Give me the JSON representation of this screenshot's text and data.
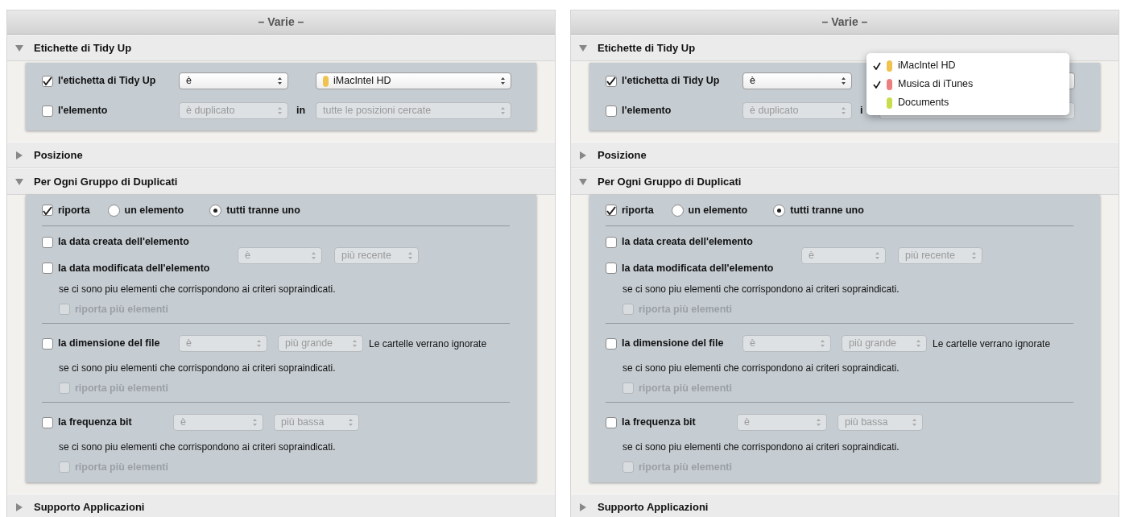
{
  "panels": [
    {
      "title": "– Varie –",
      "sections": [
        {
          "title": "Etichette di Tidy Up",
          "expanded": true,
          "rows": [
            {
              "kind": "tag",
              "items": [
                {
                  "kind": "checkbox",
                  "label": "l'etichetta di Tidy Up",
                  "checked": true,
                  "disabled": false
                },
                {
                  "kind": "popup",
                  "value": "è",
                  "disabled": false
                },
                {
                  "kind": "popup",
                  "value": "iMacIntel HD",
                  "disabled": false,
                  "color": "#f0c24e"
                }
              ]
            },
            {
              "kind": "tag",
              "items": [
                {
                  "kind": "checkbox",
                  "label": "l'elemento",
                  "checked": false,
                  "disabled": false
                },
                {
                  "kind": "popup",
                  "value": "è duplicato",
                  "disabled": true
                },
                {
                  "kind": "text",
                  "text": "in"
                },
                {
                  "kind": "popup",
                  "value": "tutte le posizioni cercate",
                  "disabled": true
                }
              ]
            }
          ]
        },
        {
          "title": "Posizione",
          "expanded": false
        },
        {
          "title": "Per Ogni Gruppo di Duplicati",
          "expanded": true,
          "rows": [
            {
              "kind": "choice",
              "items": [
                {
                  "kind": "checkbox",
                  "label": "riporta",
                  "checked": true,
                  "disabled": false
                },
                {
                  "kind": "radio",
                  "label": "un elemento",
                  "selected": false
                },
                {
                  "kind": "radio",
                  "label": "tutti tranne uno",
                  "selected": true
                }
              ]
            },
            {
              "kind": "divider"
            },
            {
              "kind": "date",
              "items": [
                {
                  "kind": "checkbox",
                  "label": "la data creata dell'elemento",
                  "checked": false,
                  "disabled": false
                },
                {
                  "kind": "checkbox",
                  "label": "la data modificata dell'elemento",
                  "checked": false,
                  "disabled": false
                },
                {
                  "kind": "popup",
                  "value": "è",
                  "disabled": true
                },
                {
                  "kind": "popup",
                  "value": "più recente",
                  "disabled": true
                }
              ]
            },
            {
              "kind": "note",
              "text": "se ci sono piu elementi che corrispondono ai criteri sopraindicati."
            },
            {
              "kind": "sub",
              "items": [
                {
                  "kind": "checkbox",
                  "label": "riporta più elementi",
                  "checked": false,
                  "disabled": true
                }
              ]
            },
            {
              "kind": "divider"
            },
            {
              "kind": "size",
              "items": [
                {
                  "kind": "checkbox",
                  "label": "la dimensione del file",
                  "checked": false,
                  "disabled": false
                },
                {
                  "kind": "popup",
                  "value": "è",
                  "disabled": true
                },
                {
                  "kind": "popup",
                  "value": "più grande",
                  "disabled": true
                },
                {
                  "kind": "text",
                  "text": "Le cartelle verrano ignorate"
                }
              ]
            },
            {
              "kind": "note",
              "text": "se ci sono piu elementi che corrispondono ai criteri sopraindicati."
            },
            {
              "kind": "sub",
              "items": [
                {
                  "kind": "checkbox",
                  "label": "riporta più elementi",
                  "checked": false,
                  "disabled": true
                }
              ]
            },
            {
              "kind": "divider"
            },
            {
              "kind": "bitrate",
              "items": [
                {
                  "kind": "checkbox",
                  "label": "la frequenza bit",
                  "checked": false,
                  "disabled": false
                },
                {
                  "kind": "popup",
                  "value": "è",
                  "disabled": true
                },
                {
                  "kind": "popup",
                  "value": "più bassa",
                  "disabled": true
                }
              ]
            },
            {
              "kind": "note",
              "text": "se ci sono piu elementi che corrispondono ai criteri sopraindicati."
            },
            {
              "kind": "sub",
              "items": [
                {
                  "kind": "checkbox",
                  "label": "riporta più elementi",
                  "checked": false,
                  "disabled": true
                }
              ]
            }
          ]
        },
        {
          "title": "Supporto Applicazioni",
          "expanded": false
        }
      ]
    },
    {
      "title": "– Varie –",
      "menu": [
        {
          "label": "iMacIntel HD",
          "checked": true,
          "color": "#f0c24e"
        },
        {
          "label": "Musica di iTunes",
          "checked": true,
          "color": "#ec8080"
        },
        {
          "label": "Documents",
          "checked": false,
          "color": "#c9dc4c"
        }
      ],
      "sections": [
        {
          "title": "Etichette di Tidy Up",
          "expanded": true,
          "rows": [
            {
              "kind": "tag",
              "items": [
                {
                  "kind": "checkbox",
                  "label": "l'etichetta di Tidy Up",
                  "checked": true,
                  "disabled": false
                },
                {
                  "kind": "popup",
                  "value": "è",
                  "disabled": false
                },
                {
                  "kind": "popup",
                  "disabled": false
                }
              ]
            },
            {
              "kind": "tag",
              "items": [
                {
                  "kind": "checkbox",
                  "label": "l'elemento",
                  "checked": false,
                  "disabled": false
                },
                {
                  "kind": "popup",
                  "value": "è duplicato",
                  "disabled": true
                },
                {
                  "kind": "text",
                  "text": "i"
                },
                {
                  "kind": "popup",
                  "disabled": true
                }
              ]
            }
          ]
        },
        {
          "title": "Posizione",
          "expanded": false
        },
        {
          "title": "Per Ogni Gruppo di Duplicati",
          "expanded": true,
          "rows": [
            {
              "kind": "choice",
              "items": [
                {
                  "kind": "checkbox",
                  "label": "riporta",
                  "checked": true,
                  "disabled": false
                },
                {
                  "kind": "radio",
                  "label": "un elemento",
                  "selected": false
                },
                {
                  "kind": "radio",
                  "label": "tutti tranne uno",
                  "selected": true
                }
              ]
            },
            {
              "kind": "divider"
            },
            {
              "kind": "date",
              "items": [
                {
                  "kind": "checkbox",
                  "label": "la data creata dell'elemento",
                  "checked": false,
                  "disabled": false
                },
                {
                  "kind": "checkbox",
                  "label": "la data modificata dell'elemento",
                  "checked": false,
                  "disabled": false
                },
                {
                  "kind": "popup",
                  "value": "è",
                  "disabled": true
                },
                {
                  "kind": "popup",
                  "value": "più recente",
                  "disabled": true
                }
              ]
            },
            {
              "kind": "note",
              "text": "se ci sono piu elementi che corrispondono ai criteri sopraindicati."
            },
            {
              "kind": "sub",
              "items": [
                {
                  "kind": "checkbox",
                  "label": "riporta più elementi",
                  "checked": false,
                  "disabled": true
                }
              ]
            },
            {
              "kind": "divider"
            },
            {
              "kind": "size",
              "items": [
                {
                  "kind": "checkbox",
                  "label": "la dimensione del file",
                  "checked": false,
                  "disabled": false
                },
                {
                  "kind": "popup",
                  "value": "è",
                  "disabled": true
                },
                {
                  "kind": "popup",
                  "value": "più grande",
                  "disabled": true
                },
                {
                  "kind": "text",
                  "text": "Le cartelle verrano ignorate"
                }
              ]
            },
            {
              "kind": "note",
              "text": "se ci sono piu elementi che corrispondono ai criteri sopraindicati."
            },
            {
              "kind": "sub",
              "items": [
                {
                  "kind": "checkbox",
                  "label": "riporta più elementi",
                  "checked": false,
                  "disabled": true
                }
              ]
            },
            {
              "kind": "divider"
            },
            {
              "kind": "bitrate",
              "items": [
                {
                  "kind": "checkbox",
                  "label": "la frequenza bit",
                  "checked": false,
                  "disabled": false
                },
                {
                  "kind": "popup",
                  "value": "è",
                  "disabled": true
                },
                {
                  "kind": "popup",
                  "value": "più bassa",
                  "disabled": true
                }
              ]
            },
            {
              "kind": "note",
              "text": "se ci sono piu elementi che corrispondono ai criteri sopraindicati."
            },
            {
              "kind": "sub",
              "items": [
                {
                  "kind": "checkbox",
                  "label": "riporta più elementi",
                  "checked": false,
                  "disabled": true
                }
              ]
            }
          ]
        },
        {
          "title": "Supporto Applicazioni",
          "expanded": false
        }
      ]
    }
  ]
}
